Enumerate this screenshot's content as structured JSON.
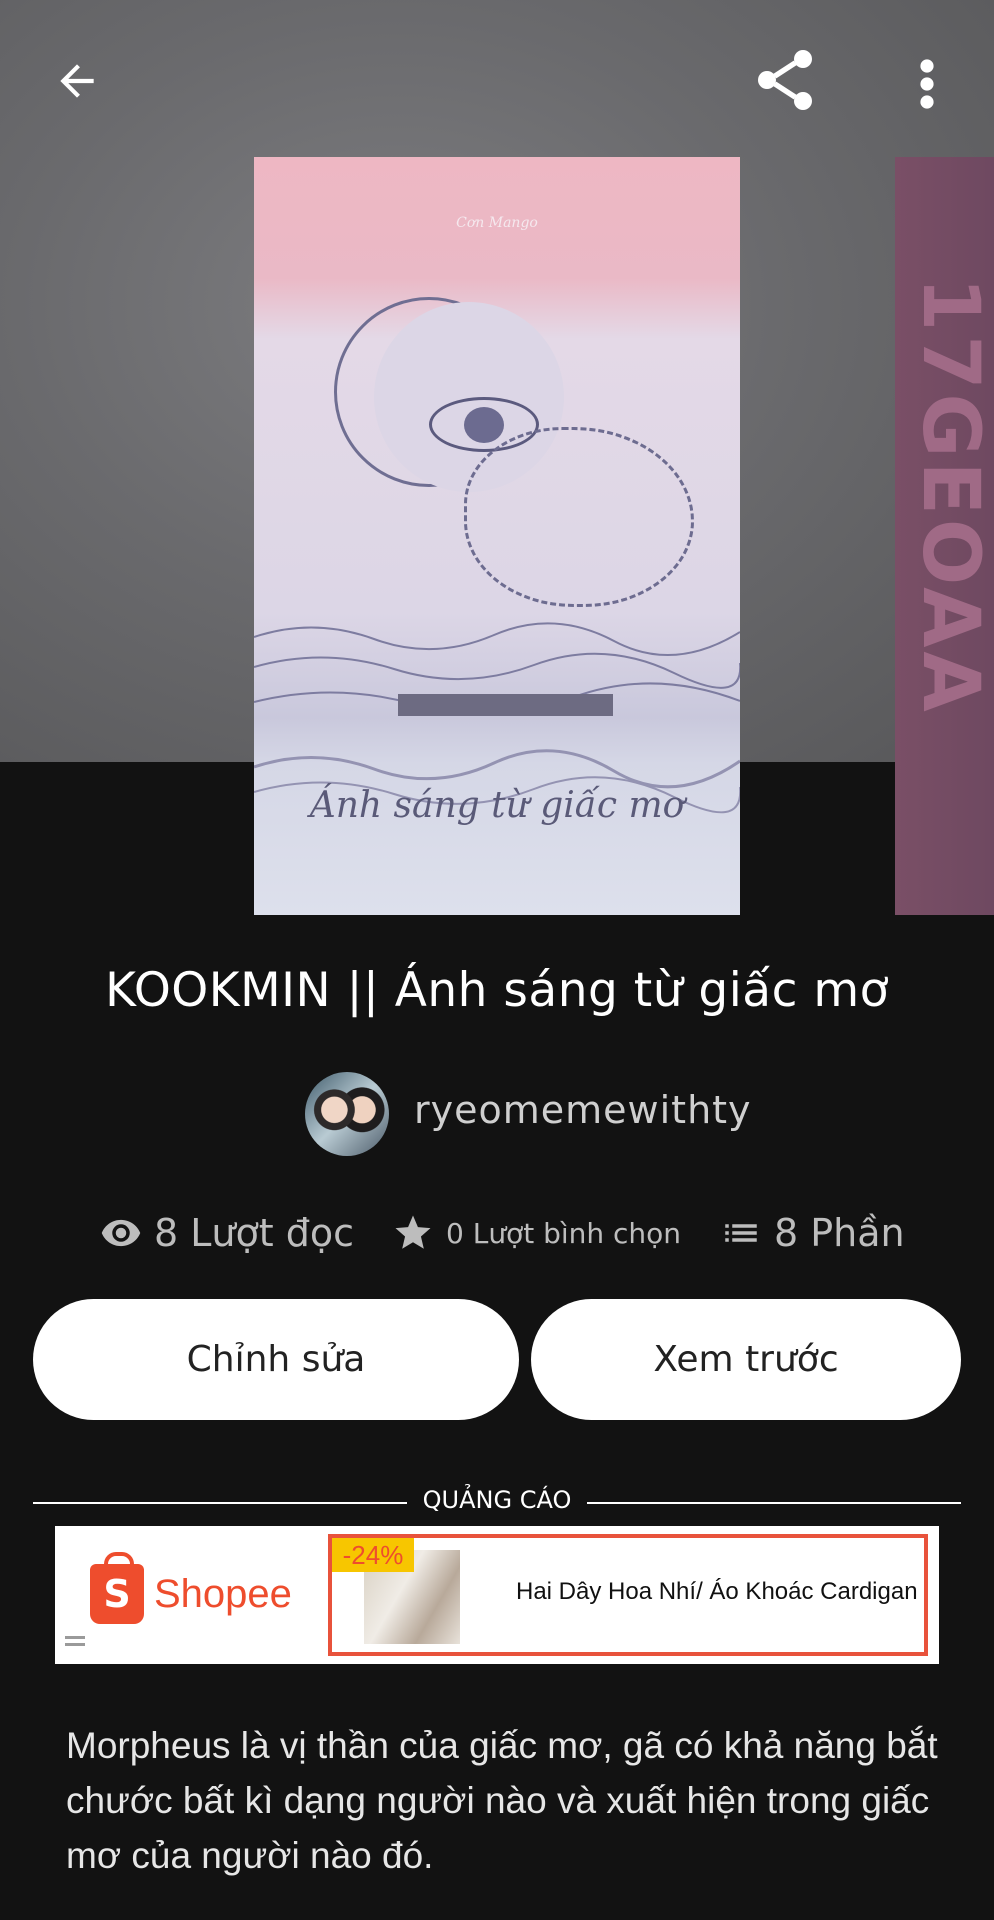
{
  "toolbar": {
    "back_icon": "arrow-left-icon",
    "share_icon": "share-icon",
    "more_icon": "more-vertical-icon"
  },
  "cover": {
    "signature": "Cơn Mango",
    "title_text": "Ánh sáng từ giấc mơ",
    "next_cover_text": "17GEOAA"
  },
  "story": {
    "title": "KOOKMIN || Ánh sáng từ giấc mơ",
    "author": "ryeomemewithty",
    "stats": {
      "reads": "8 Lượt đọc",
      "votes": "0 Lượt bình chọn",
      "parts": "8 Phần"
    }
  },
  "actions": {
    "edit_label": "Chỉnh sửa",
    "preview_label": "Xem trước"
  },
  "ad": {
    "label": "QUẢNG CÁO",
    "brand": "Shopee",
    "discount": "-24%",
    "product_name": "Hai Dây Hoa Nhí/ Áo Khoác Cardigan"
  },
  "description": "Morpheus là vị thần của giấc mơ, gã có khả năng bắt chước bất kì dạng người nào và xuất hiện trong giấc mơ của người nào đó.",
  "colors": {
    "background": "#121212",
    "shopee": "#ee4d2d",
    "button_bg": "#ffffff"
  }
}
